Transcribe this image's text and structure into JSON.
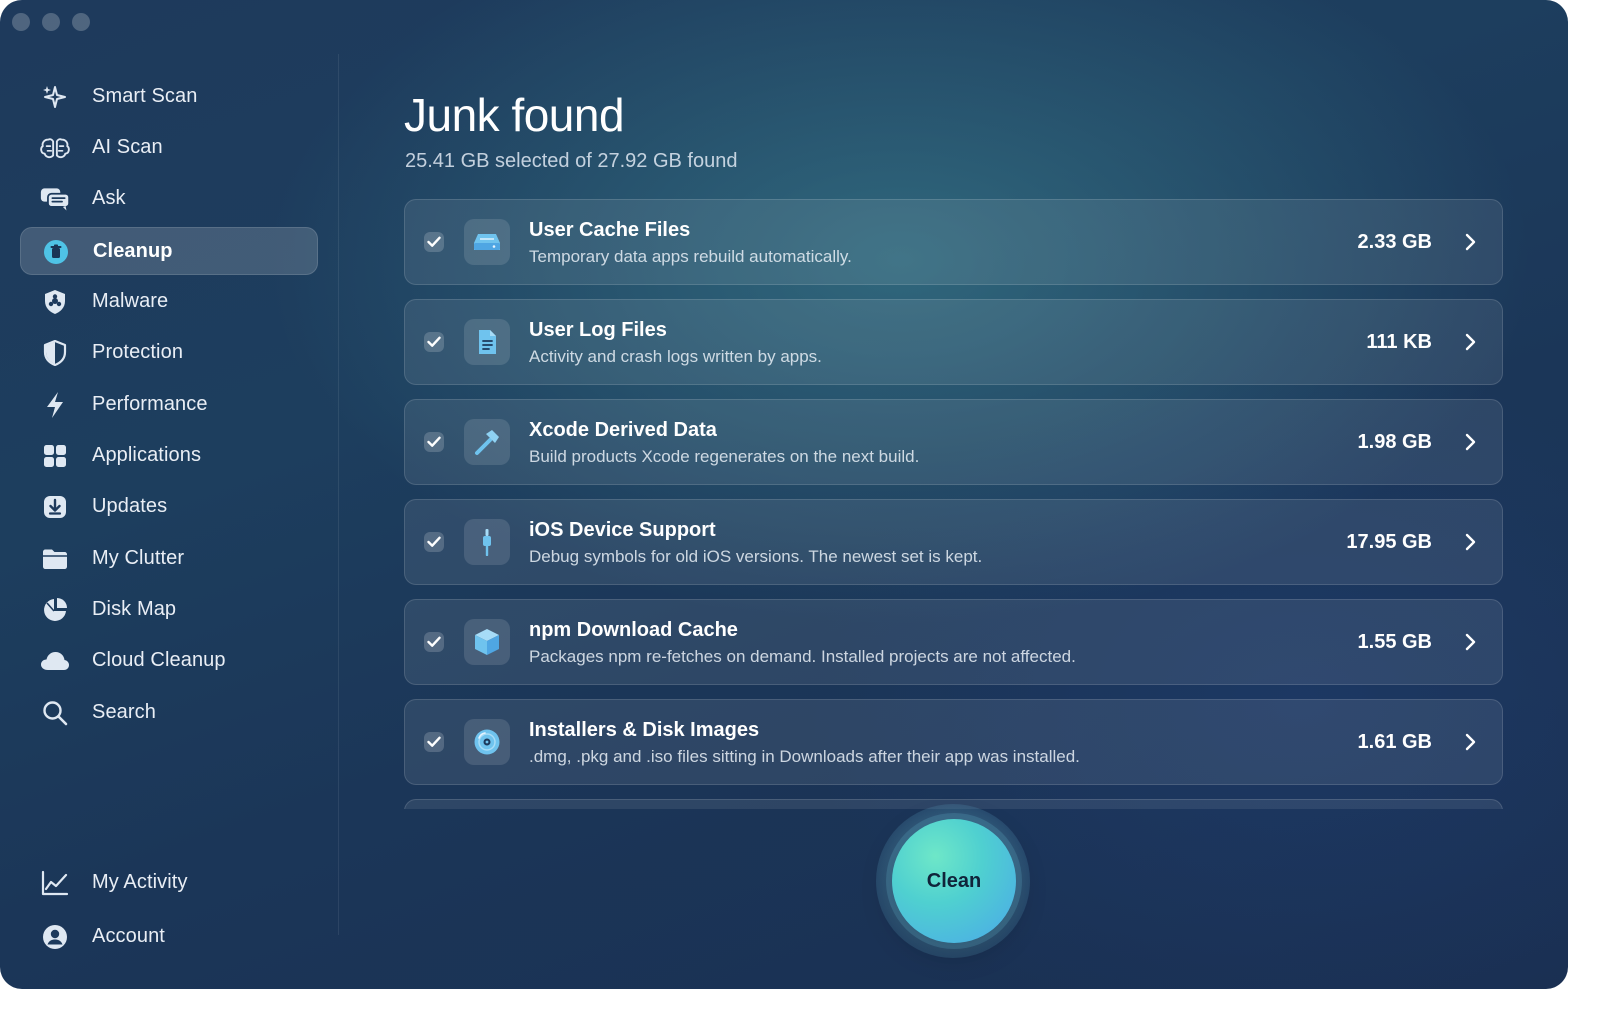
{
  "sidebar": {
    "items": [
      {
        "label": "Smart Scan",
        "icon": "sparkles-icon"
      },
      {
        "label": "AI Scan",
        "icon": "brain-icon"
      },
      {
        "label": "Ask",
        "icon": "chat-bubbles-icon"
      },
      {
        "label": "Cleanup",
        "icon": "trash-icon",
        "active": true
      },
      {
        "label": "Malware",
        "icon": "biohazard-shield-icon"
      },
      {
        "label": "Protection",
        "icon": "shield-icon"
      },
      {
        "label": "Performance",
        "icon": "bolt-icon"
      },
      {
        "label": "Applications",
        "icon": "grid-icon"
      },
      {
        "label": "Updates",
        "icon": "download-icon"
      },
      {
        "label": "My Clutter",
        "icon": "folder-icon"
      },
      {
        "label": "Disk Map",
        "icon": "pie-chart-icon"
      },
      {
        "label": "Cloud Cleanup",
        "icon": "cloud-icon"
      },
      {
        "label": "Search",
        "icon": "search-icon"
      }
    ],
    "footer_items": [
      {
        "label": "My Activity",
        "icon": "line-chart-icon"
      },
      {
        "label": "Account",
        "icon": "person-icon"
      }
    ]
  },
  "main": {
    "title": "Junk found",
    "subtitle": "25.41 GB selected of 27.92 GB found",
    "rows": [
      {
        "title": "User Cache Files",
        "description": "Temporary data apps rebuild automatically.",
        "size": "2.33 GB",
        "icon": "drive-icon",
        "checked": true
      },
      {
        "title": "User Log Files",
        "description": "Activity and crash logs written by apps.",
        "size": "111 KB",
        "icon": "document-icon",
        "checked": true
      },
      {
        "title": "Xcode Derived Data",
        "description": "Build products Xcode regenerates on the next build.",
        "size": "1.98 GB",
        "icon": "hammer-icon",
        "checked": true
      },
      {
        "title": "iOS Device Support",
        "description": "Debug symbols for old iOS versions. The newest set is kept.",
        "size": "17.95 GB",
        "icon": "cable-icon",
        "checked": true
      },
      {
        "title": "npm Download Cache",
        "description": "Packages npm re-fetches on demand. Installed projects are not affected.",
        "size": "1.55 GB",
        "icon": "package-icon",
        "checked": true
      },
      {
        "title": "Installers & Disk Images",
        "description": ".dmg, .pkg and .iso files sitting in Downloads after their app was installed.",
        "size": "1.61 GB",
        "icon": "disc-icon",
        "checked": true
      }
    ],
    "clean_label": "Clean"
  },
  "colors": {
    "accent_start": "#6ee7c8",
    "accent_end": "#4ba7ea",
    "cleanup_icon": "#4fc3e6"
  }
}
